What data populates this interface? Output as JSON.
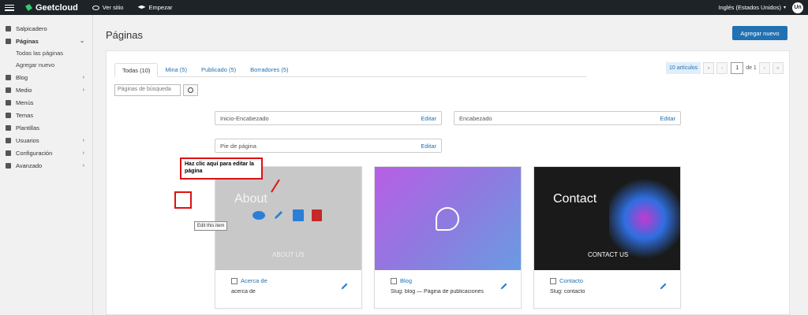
{
  "topbar": {
    "logo": "Geetcloud",
    "view_site": "Ver sitio",
    "start": "Empezar",
    "language": "Inglés (Estados Unidos)",
    "avatar_initials": "Un"
  },
  "sidebar": {
    "items": [
      {
        "label": "Salpicadero"
      },
      {
        "label": "Páginas",
        "chevron": "⌄"
      },
      {
        "label": "Todas las páginas"
      },
      {
        "label": "Agregar nuevo"
      },
      {
        "label": "Blog",
        "chevron": "›"
      },
      {
        "label": "Medio",
        "chevron": "›"
      },
      {
        "label": "Menús"
      },
      {
        "label": "Temas"
      },
      {
        "label": "Plantillas"
      },
      {
        "label": "Usuarios",
        "chevron": "›"
      },
      {
        "label": "Configuración",
        "chevron": "›"
      },
      {
        "label": "Avanzado",
        "chevron": "›"
      }
    ]
  },
  "main": {
    "title": "Páginas",
    "add_button": "Agregar nuevo",
    "tabs": [
      {
        "label": "Todas (10)"
      },
      {
        "label": "Mina (5)"
      },
      {
        "label": "Publicado (5)"
      },
      {
        "label": "Borradores (5)"
      }
    ],
    "search_placeholder": "Páginas de búsqueda",
    "pagination": {
      "count": "10 artículos",
      "current": "1",
      "of": "de 1"
    },
    "sections": [
      {
        "label": "Inicio-Encabezado",
        "edit": "Editar"
      },
      {
        "label": "Encabezado",
        "edit": "Editar"
      },
      {
        "label": "Pie de página",
        "edit": "Editar"
      }
    ],
    "cards": [
      {
        "title": "Acerca de",
        "slug": "acerca de",
        "thumb_text": "About",
        "thumb_sub": "ABOUT US"
      },
      {
        "title": "Blog",
        "slug": "Slug: blog — Página de publicaciones"
      },
      {
        "title": "Contacto",
        "slug": "Slug: contacto",
        "thumb_text": "Contact",
        "thumb_sub": "CONTACT US"
      }
    ],
    "callout": "Haz clic aquí para editar la página",
    "tooltip": "Edit this item"
  },
  "colors": {
    "accent": "#2271b1",
    "topbar": "#1d2327",
    "highlight": "#dd1111"
  }
}
